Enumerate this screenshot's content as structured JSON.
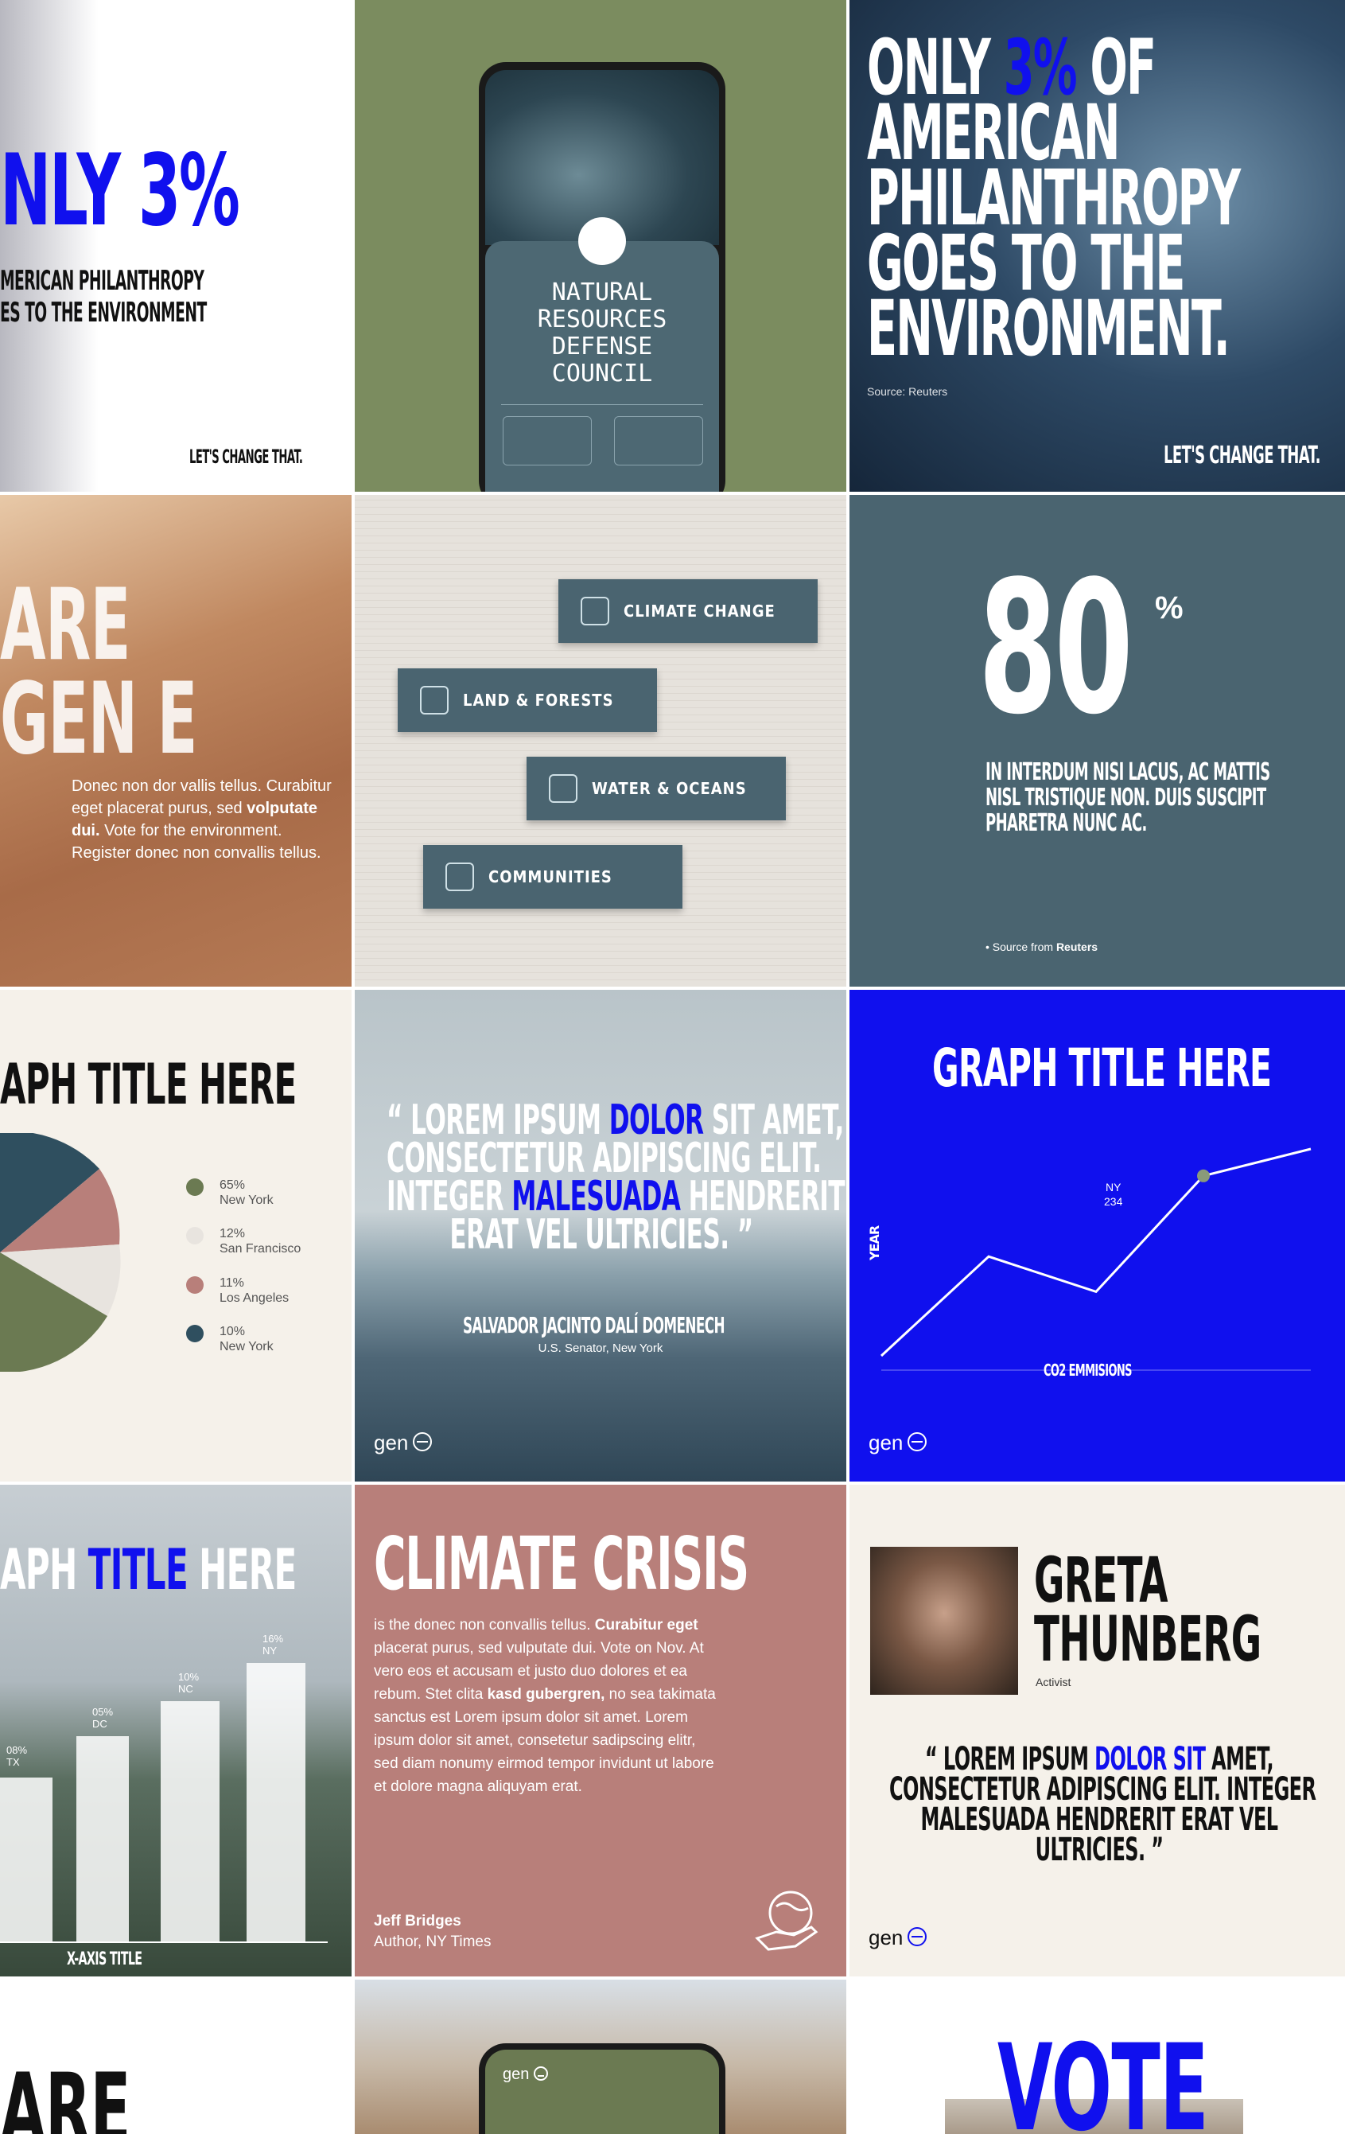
{
  "colors": {
    "blue": "#1010ee",
    "olive": "#7b8c5f",
    "slate": "#4a6470",
    "rose": "#b87f7a",
    "cream": "#f5f1ea"
  },
  "tile_only3": {
    "headline": "NLY 3%",
    "sub1": "MERICAN PHILANTHROPY",
    "sub2": "ES TO THE ENVIRONMENT",
    "cta": "LET'S CHANGE THAT."
  },
  "tile_phone": {
    "org_line1": "NATURAL",
    "org_line2": "RESOURCES",
    "org_line3": "DEFENSE",
    "org_line4": "COUNCIL",
    "icon": "whale-shark-photo"
  },
  "tile_forest": {
    "line1a": "ONLY ",
    "line1b": "3%",
    "line1c": " OF",
    "line2": "AMERICAN",
    "line3": "PHILANTHROPY",
    "line4": "GOES TO THE",
    "line5": "ENVIRONMENT.",
    "source": "Source: Reuters",
    "cta": "LET'S CHANGE THAT."
  },
  "tile_desert": {
    "line1": "ARE",
    "line2": "GEN E",
    "body": "Donec non dor vallis tellus. Curabitur eget placerat purus, sed ",
    "body_bold": "volputate dui.",
    "body2": " Vote for the environment. Register donec non convallis tellus."
  },
  "tile_categories": {
    "items": [
      {
        "label": "CLIMATE CHANGE",
        "icon": "globe-icon"
      },
      {
        "label": "LAND & FORESTS",
        "icon": "trees-icon"
      },
      {
        "label": "WATER & OCEANS",
        "icon": "waves-icon"
      },
      {
        "label": "COMMUNITIES",
        "icon": "people-icon"
      }
    ]
  },
  "tile_stat": {
    "number": "80",
    "unit": "%",
    "text1": "IN INTERDUM NISI LACUS, AC MATTIS",
    "text2": "NISL TRISTIQUE NON. DUIS SUSCIPIT",
    "text3": "PHARETRA NUNC AC.",
    "source_prefix": "• Source from ",
    "source_name": "Reuters"
  },
  "tile_pie": {
    "title": "APH TITLE HERE",
    "legend": [
      {
        "pct": "65%",
        "city": "New York",
        "color": "#6b7a52"
      },
      {
        "pct": "12%",
        "city": "San Francisco",
        "color": "#e8e4df"
      },
      {
        "pct": "11%",
        "city": "Los Angeles",
        "color": "#b87f7a"
      },
      {
        "pct": "10%",
        "city": "New York",
        "color": "#2f4f5f"
      }
    ]
  },
  "tile_quote": {
    "q1a": "“ LOREM IPSUM ",
    "q1b": "DOLOR",
    "q1c": " SIT AMET,",
    "q2": "CONSECTETUR ADIPISCING ELIT.",
    "q3a": "INTEGER ",
    "q3b": "MALESUADA",
    "q3c": " HENDRERIT",
    "q4": "ERAT VEL ULTRICIES. ”",
    "author": "SALVADOR JACINTO DALÍ DOMENECH",
    "role": "U.S. Senator, New York",
    "brand": "gen"
  },
  "chart_data": {
    "type": "line",
    "title": "GRAPH TITLE HERE",
    "xlabel": "CO2 EMMISIONS",
    "ylabel": "YEAR",
    "series": [
      {
        "values": [
          0,
          0.48,
          0.31,
          0.87,
          1.0
        ]
      }
    ],
    "annotation": {
      "label": "NY",
      "value": "234"
    },
    "ylim": [
      0,
      1
    ]
  },
  "tile_bars": {
    "title_a": "APH ",
    "title_b": "TITLE",
    "title_c": " HERE",
    "xlabel": "X-AXIS TITLE",
    "bars": [
      {
        "pct": "08%",
        "label": "TX"
      },
      {
        "pct": "05%",
        "label": "DC"
      },
      {
        "pct": "10%",
        "label": "NC"
      },
      {
        "pct": "16%",
        "label": "NY"
      }
    ]
  },
  "tile_crisis": {
    "title": "CLIMATE CRISIS",
    "body1": "is the donec non convallis tellus. ",
    "body_bold1": "Curabitur eget",
    "body2": " placerat purus, sed vulputate dui. Vote on Nov. At vero eos et accusam et justo duo dolores et ea rebum. Stet clita ",
    "body_bold2": "kasd gubergren,",
    "body3": " no sea takimata sanctus est Lorem ipsum dolor sit amet. Lorem ipsum dolor sit amet, consetetur sadipscing elitr, sed diam nonumy eirmod tempor invidunt ut labore et dolore magna aliquyam erat.",
    "author": "Jeff Bridges",
    "role": "Author, NY Times"
  },
  "tile_greta": {
    "name1": "GRETA",
    "name2": "THUNBERG",
    "role": "Activist",
    "q1a": "“ LOREM IPSUM ",
    "q1b": "DOLOR SIT",
    "q1c": " AMET,",
    "q2": "CONSECTETUR ADIPISCING ELIT. INTEGER",
    "q3": "MALESUADA HENDRERIT ERAT VEL",
    "q4": "ULTRICIES. ”",
    "brand": "gen"
  },
  "tile_row5": {
    "are": "ARE",
    "vote": "VOTE",
    "phone_brand": "gen"
  }
}
